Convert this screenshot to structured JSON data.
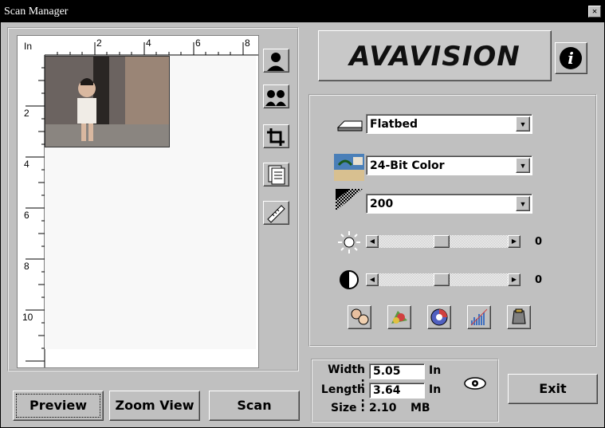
{
  "window": {
    "title": "Scan Manager",
    "close_glyph": "×"
  },
  "ruler": {
    "unit": "In",
    "x_labels": [
      "2",
      "4",
      "6",
      "8"
    ],
    "y_labels": [
      "2",
      "4",
      "6",
      "8",
      "10"
    ]
  },
  "tools": [
    "portrait-icon",
    "dual-portrait-icon",
    "crop-icon",
    "multi-page-icon",
    "measure-icon"
  ],
  "logo": {
    "text": "AVAVISION"
  },
  "info_icon": "i",
  "settings": {
    "source": "Flatbed",
    "color_mode": "24-Bit Color",
    "resolution": "200",
    "brightness": "0",
    "brightness_level": 0.5,
    "contrast": "0",
    "contrast_level": 0.5
  },
  "info": {
    "width_label": "Width :",
    "width_value": "5.05",
    "width_unit": "In",
    "length_label": "Length :",
    "length_value": "3.64",
    "length_unit": "In",
    "size_label": "Size :",
    "size_value": "2.10",
    "size_unit": "MB"
  },
  "buttons": {
    "preview": "Preview",
    "zoom_view": "Zoom View",
    "scan": "Scan",
    "exit": "Exit"
  }
}
